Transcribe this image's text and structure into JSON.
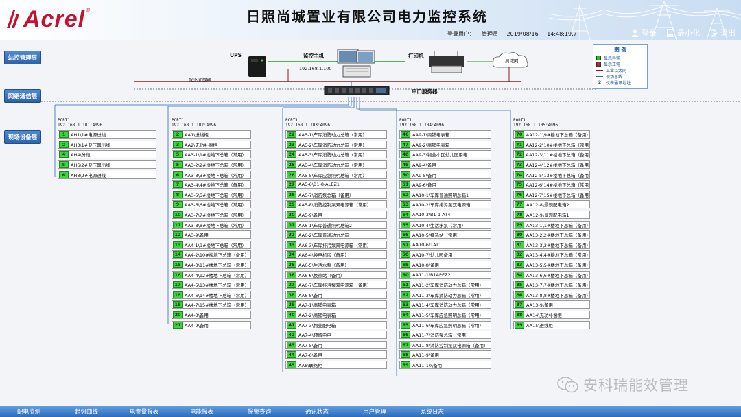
{
  "header": {
    "logo_text": "Acrel",
    "logo_reg": "®",
    "title": "日照尚城置业有限公司电力监控系统",
    "user_label": "登录用户：",
    "user_name": "管理员",
    "date": "2019/08/16",
    "time": "14:48:19.7",
    "btn_login": "登录",
    "btn_minimize": "最小化",
    "btn_exit": "退出"
  },
  "layers": {
    "station": "站控管理层",
    "network": "网络通信层",
    "field": "现场设备层"
  },
  "devices": {
    "ups": "UPS",
    "host": "监控主机",
    "host_ip": "192.168.1.100",
    "printer": "打印机",
    "lan": "局域网",
    "tcpip": "TCP/IP网络",
    "serial": "串口服务器"
  },
  "legend": {
    "title": "图 例",
    "items": [
      {
        "label": "显示异常",
        "color": "#22c422",
        "kind": "square"
      },
      {
        "label": "显示正常",
        "color": "#d11a1a",
        "kind": "square"
      },
      {
        "label": "工业以太网",
        "color": "#8b1a1a",
        "kind": "line"
      },
      {
        "label": "现场总线",
        "color": "#2d6ab9",
        "kind": "thin"
      },
      {
        "label": "仪表通讯地址",
        "num": "2",
        "kind": "num"
      }
    ]
  },
  "ports": [
    {
      "name": "PORT1",
      "ip": "192.168.1.101:4096",
      "rows": [
        {
          "n": "1",
          "t": "AH1\\1#电源进线"
        },
        {
          "n": "2",
          "t": "AH3\\1#变压器出线"
        },
        {
          "n": "4",
          "t": "AH4\\分段"
        },
        {
          "n": "5",
          "t": "AH6\\2#变压器出线"
        },
        {
          "n": "6",
          "t": "AH8\\2#电源进线"
        }
      ]
    },
    {
      "name": "PORT1",
      "ip": "192.168.1.102:4096",
      "rows": [
        {
          "n": "2",
          "t": "AA1\\进线柜"
        },
        {
          "n": "3",
          "t": "AA2\\无功补偿柜"
        },
        {
          "n": "5",
          "t": "AA3-1\\1#楼地下总箱（常用）"
        },
        {
          "n": "5",
          "t": "AA3-2\\2#楼地下总箱（常用）"
        },
        {
          "n": "6",
          "t": "AA3-3\\3#楼地下总箱（常用）"
        },
        {
          "n": "7",
          "t": "AA3-4\\4#楼地下总箱（备用）"
        },
        {
          "n": "8",
          "t": "AA3-5\\5#楼地下总箱（常用）"
        },
        {
          "n": "9",
          "t": "AA3-6\\6#楼地下总箱（常用）"
        },
        {
          "n": "10",
          "t": "AA3-7\\7#楼地下总箱（常用）"
        },
        {
          "n": "11",
          "t": "AA3-8\\8#楼地下总箱（常用）"
        },
        {
          "n": "12",
          "t": "AA3-9\\备用"
        },
        {
          "n": "13",
          "t": "AA4-1\\9#楼地下总箱（常用）"
        },
        {
          "n": "14",
          "t": "AA4-2\\10#楼地下总箱（备用）"
        },
        {
          "n": "15",
          "t": "AA4-3\\11#楼地下总箱（常用）"
        },
        {
          "n": "16",
          "t": "AA4-4\\12#楼地下总箱（常用）"
        },
        {
          "n": "17",
          "t": "AA4-5\\13#楼地下总箱（常用）"
        },
        {
          "n": "18",
          "t": "AA4-6\\14#楼地下总箱（常用）"
        },
        {
          "n": "19",
          "t": "AA4-7\\15#楼地下总箱（常用）"
        },
        {
          "n": "20",
          "t": "AA4-8\\备用"
        },
        {
          "n": "21",
          "t": "AA4-9\\备用"
        }
      ]
    },
    {
      "name": "PORT1",
      "ip": "192.168.1.103:4096",
      "rows": [
        {
          "n": "22",
          "t": "AA5-1\\车库消防动力总箱（常用）"
        },
        {
          "n": "23",
          "t": "AA5-2\\车库消防动力总箱（常用）"
        },
        {
          "n": "24",
          "t": "AA5-3\\车库消防动力总箱（常用）"
        },
        {
          "n": "25",
          "t": "AA5-4\\车库消防动力总箱（常用）"
        },
        {
          "n": "26",
          "t": "AA5-5\\车库应急照明总箱（常用）"
        },
        {
          "n": "27",
          "t": "AA5-6\\B1-8-ALEZ1"
        },
        {
          "n": "28",
          "t": "AA5-7\\消防泵总箱（备用）"
        },
        {
          "n": "29",
          "t": "AA5-8\\消防控制泵双电源箱（常用）"
        },
        {
          "n": "30",
          "t": "AA5-9\\备用"
        },
        {
          "n": "31",
          "t": "AA6-1\\车库普通照明总箱2"
        },
        {
          "n": "32",
          "t": "AA6-2\\车库普通动力总箱"
        },
        {
          "n": "33",
          "t": "AA6-3\\车库排污泵双电源箱（常用）"
        },
        {
          "n": "34",
          "t": "AA6-4\\换电机房（备用）"
        },
        {
          "n": "35",
          "t": "AA6-5\\生活水泵（备用）"
        },
        {
          "n": "36",
          "t": "AA6-6\\换热站（备用）"
        },
        {
          "n": "37",
          "t": "AA6-7\\车库排污泵双电源箱（备用）"
        },
        {
          "n": "38",
          "t": "AA6-8\\备用"
        },
        {
          "n": "39",
          "t": "AA7-1\\商铺电表箱"
        },
        {
          "n": "40",
          "t": "AA7-2\\商铺电表箱"
        },
        {
          "n": "41",
          "t": "AA7-3\\物业配电箱"
        },
        {
          "n": "42",
          "t": "AA7-4\\预留电电"
        },
        {
          "n": "43",
          "t": "AA7-5\\备用"
        },
        {
          "n": "44",
          "t": "AA7-6\\备用"
        },
        {
          "n": "45",
          "t": "AA8\\联络柜"
        }
      ]
    },
    {
      "name": "PORT1",
      "ip": "192.168.1.104:4096",
      "rows": [
        {
          "n": "46",
          "t": "AA9-1\\商铺电表箱"
        },
        {
          "n": "47",
          "t": "AA9-2\\商铺电表箱"
        },
        {
          "n": "48",
          "t": "AA9-3\\物业小区幼儿园用电"
        },
        {
          "n": "49",
          "t": "AA9-4\\备用"
        },
        {
          "n": "50",
          "t": "AA9-5\\备用"
        },
        {
          "n": "51",
          "t": "AA9-6\\备用"
        },
        {
          "n": "52",
          "t": "AA10-1\\车库普通照明总箱1"
        },
        {
          "n": "53",
          "t": "AA10-2\\车库排污泵双电源箱"
        },
        {
          "n": "54",
          "t": "AA10-3\\B1-1-AT4"
        },
        {
          "n": "55",
          "t": "AA10-4\\生活水泵（常用）"
        },
        {
          "n": "56",
          "t": "AA10-5\\换热站（常用）"
        },
        {
          "n": "57",
          "t": "AA10-6\\1AT1"
        },
        {
          "n": "58",
          "t": "AA10-7\\幼儿园备用"
        },
        {
          "n": "59",
          "t": "AA10-8\\备用"
        },
        {
          "n": "60",
          "t": "AA11-1\\B1APEZ2"
        },
        {
          "n": "61",
          "t": "AA11-2\\车库消防动力总箱（常用）"
        },
        {
          "n": "62",
          "t": "AA11-3\\车库消防动力总箱（常用）"
        },
        {
          "n": "63",
          "t": "AA11-4\\车库消防动力总箱（常用）"
        },
        {
          "n": "64",
          "t": "AA11-5\\车库应急照明总箱（常用）"
        },
        {
          "n": "65",
          "t": "AA11-6\\车库应急照明总箱（常用）"
        },
        {
          "n": "66",
          "t": "AA11-7\\消防泵总箱（常用）"
        },
        {
          "n": "67",
          "t": "AA11-8\\消防控制泵双电源箱（备用）"
        },
        {
          "n": "68",
          "t": "AA11-9\\备用"
        },
        {
          "n": "69",
          "t": "AA11-10\\备用"
        }
      ]
    },
    {
      "name": "PORT1",
      "ip": "192.168.1.105:4096",
      "rows": [
        {
          "n": "70",
          "t": "AA12-1\\9#楼地下总箱（备用）"
        },
        {
          "n": "71",
          "t": "AA12-2\\10#楼地下总箱（常用）"
        },
        {
          "n": "72",
          "t": "AA12-3\\11#楼地下总箱（备用）"
        },
        {
          "n": "73",
          "t": "AA12-4\\12#楼地下总箱（备用）"
        },
        {
          "n": "74",
          "t": "AA12-5\\13#楼地下总箱（备用）"
        },
        {
          "n": "75",
          "t": "AA12-6\\14#楼地下总箱（常用）"
        },
        {
          "n": "76",
          "t": "AA12-7\\15#楼地下总箱（备用）"
        },
        {
          "n": "77",
          "t": "AA12-8\\景观配电箱2"
        },
        {
          "n": "78",
          "t": "AA12-9\\景观配电箱1"
        },
        {
          "n": "79",
          "t": "AA13-1\\1#楼地下总箱（备用）"
        },
        {
          "n": "80",
          "t": "AA13-2\\2#楼地下总箱（备用）"
        },
        {
          "n": "81",
          "t": "AA13-3\\3#楼地下总箱（备用）"
        },
        {
          "n": "82",
          "t": "AA13-4\\4#楼地下总箱（常用）"
        },
        {
          "n": "83",
          "t": "AA13-5\\5#楼地下总箱（备用）"
        },
        {
          "n": "84",
          "t": "AA13-6\\6#楼地下总箱（备用）"
        },
        {
          "n": "85",
          "t": "AA13-7\\7#楼地下总箱（备用）"
        },
        {
          "n": "86",
          "t": "AA13-8\\8#楼地下总箱（备用）"
        },
        {
          "n": "87",
          "t": "AA13-9\\备用"
        },
        {
          "n": "88",
          "t": "AA14\\无功补偿柜"
        },
        {
          "n": "89",
          "t": "AA15\\进线柜"
        }
      ]
    }
  ],
  "nav": [
    "配电监测",
    "趋势曲线",
    "电参量报表",
    "电能报表",
    "报警查询",
    "通讯状态",
    "用户管理",
    "系统日志"
  ],
  "watermark": "安科瑞能效管理"
}
